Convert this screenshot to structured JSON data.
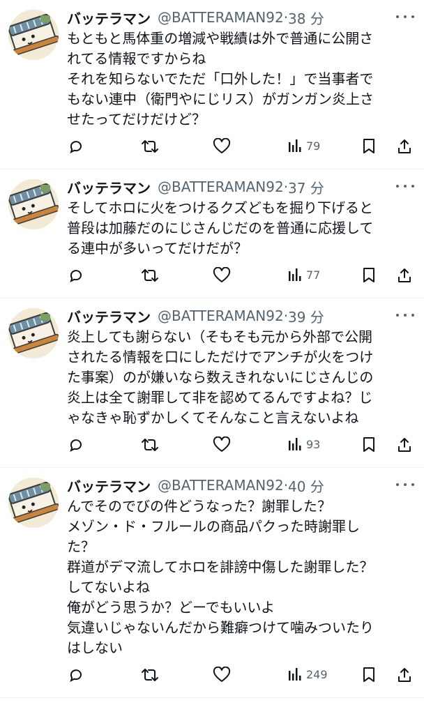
{
  "tweets": [
    {
      "name": "バッテラマン",
      "handle": "@BATTERAMAN92",
      "separator": "·",
      "time": "38 分",
      "text": "もともと馬体重の増減や戦績は外で普通に公開さ\nれてる情報ですからね\nそれを知らないでただ「口外した！」で当事者で\nもない連中（衛門やにじリス）がガンガン炎上さ\nせたってだけだけど？",
      "views": "79"
    },
    {
      "name": "バッテラマン",
      "handle": "@BATTERAMAN92",
      "separator": "·",
      "time": "37 分",
      "text": "そしてホロに火をつけるクズどもを掘り下げると\n普段は加藤だのにじさんじだのを普通に応援して\nる連中が多いってだけだが？",
      "views": "77"
    },
    {
      "name": "バッテラマン",
      "handle": "@BATTERAMAN92",
      "separator": "·",
      "time": "39 分",
      "text": "炎上しても謝らない（そもそも元から外部で公開\nされたる情報を口にしただけでアンチが火をつけ\nた事案）のが嫌いなら数えきれないにじさんじの\n炎上は全て謝罪して非を認めてるんですよね？じ\nゃなきゃ恥ずかしくてそんなこと言えないよね",
      "views": "93"
    },
    {
      "name": "バッテラマン",
      "handle": "@BATTERAMAN92",
      "separator": "·",
      "time": "40 分",
      "text": "んでそのでびの件どうなった？謝罪した？\nメゾン・ド・フルールの商品パクった時謝罪し\nた？\n群道がデマ流してホロを誹謗中傷した謝罪した？\nしてないよね\n俺がどう思うか？どーでもいいよ\n気違いじゃないんだから難癖つけて噛みついたり\nはしない",
      "views": "249"
    }
  ],
  "colors": {
    "text": "#0f1419",
    "secondary": "#536471",
    "divider": "#eff3f4"
  },
  "icons": [
    "reply-icon",
    "retweet-icon",
    "like-icon",
    "views-icon",
    "bookmark-icon",
    "share-icon",
    "more-icon",
    "avatar"
  ]
}
